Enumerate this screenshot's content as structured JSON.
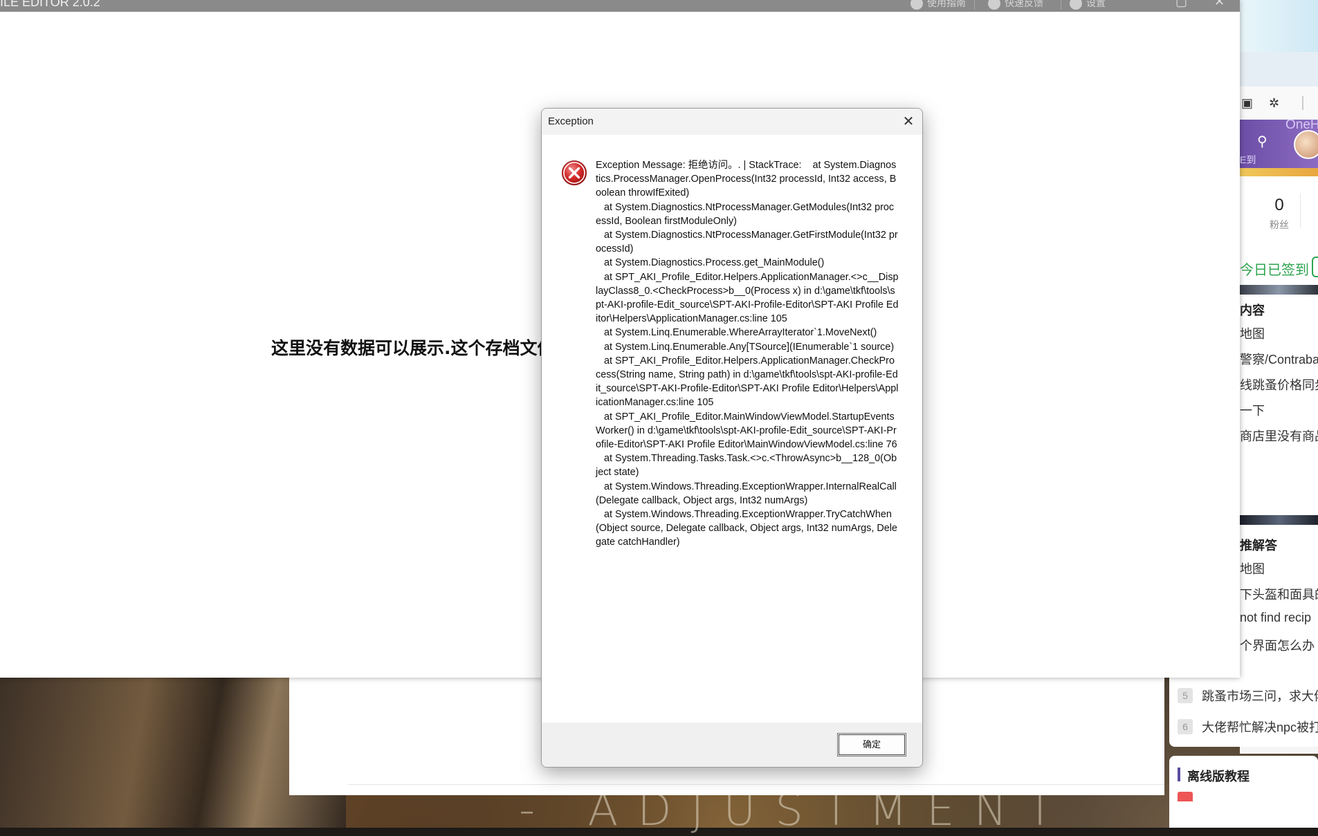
{
  "editor": {
    "title": "ILE EDITOR  2.0.2",
    "toolbar": [
      "使用指南",
      "快速反馈",
      "设置"
    ],
    "empty_message": "这里没有数据可以展示.这个存档文件"
  },
  "dialog": {
    "title": "Exception",
    "message": "Exception Message: 拒绝访问。. | StackTrace:    at System.Diagnostics.ProcessManager.OpenProcess(Int32 processId, Int32 access, Boolean throwIfExited)\n   at System.Diagnostics.NtProcessManager.GetModules(Int32 processId, Boolean firstModuleOnly)\n   at System.Diagnostics.NtProcessManager.GetFirstModule(Int32 processId)\n   at System.Diagnostics.Process.get_MainModule()\n   at SPT_AKI_Profile_Editor.Helpers.ApplicationManager.<>c__DisplayClass8_0.<CheckProcess>b__0(Process x) in d:\\game\\tkf\\tools\\spt-AKI-profile-Edit_source\\SPT-AKI-Profile-Editor\\SPT-AKI Profile Editor\\Helpers\\ApplicationManager.cs:line 105\n   at System.Linq.Enumerable.WhereArrayIterator`1.MoveNext()\n   at System.Linq.Enumerable.Any[TSource](IEnumerable`1 source)\n   at SPT_AKI_Profile_Editor.Helpers.ApplicationManager.CheckProcess(String name, String path) in d:\\game\\tkf\\tools\\spt-AKI-profile-Edit_source\\SPT-AKI-Profile-Editor\\SPT-AKI Profile Editor\\Helpers\\ApplicationManager.cs:line 105\n   at SPT_AKI_Profile_Editor.MainWindowViewModel.StartupEventsWorker() in d:\\game\\tkf\\tools\\spt-AKI-profile-Edit_source\\SPT-AKI-Profile-Editor\\SPT-AKI Profile Editor\\MainWindowViewModel.cs:line 76\n   at System.Threading.Tasks.Task.<>c.<ThrowAsync>b__128_0(Object state)\n   at System.Windows.Threading.ExceptionWrapper.InternalRealCall(Delegate callback, Object args, Int32 numArgs)\n   at System.Windows.Threading.ExceptionWrapper.TryCatchWhen(Object source, Delegate callback, Object args, Int32 numArgs, Delegate catchHandler)",
    "ok_label": "确定",
    "icon": "error-icon"
  },
  "browser": {
    "brand": "OneHund",
    "header_sub": "E到",
    "fans_count": "0",
    "fans_label": "粉丝",
    "signed_label": "今日已签到",
    "section1_title": "内容",
    "section1_items": [
      "地图",
      "警察/Contraba",
      "线跳蚤价格同步",
      "一下",
      "商店里没有商品"
    ],
    "section2_title": "推解答",
    "section2_items": [
      "地图",
      "下头盔和面具的",
      "not find recip",
      "个界面怎么办"
    ],
    "ranked_items": [
      {
        "rank": "5",
        "text": "跳蚤市场三问，求大佬"
      },
      {
        "rank": "6",
        "text": "大佬帮忙解决npc被打"
      }
    ],
    "tutorial_title": "离线版教程"
  },
  "background": {
    "text": "- ADJUSTMENT"
  }
}
